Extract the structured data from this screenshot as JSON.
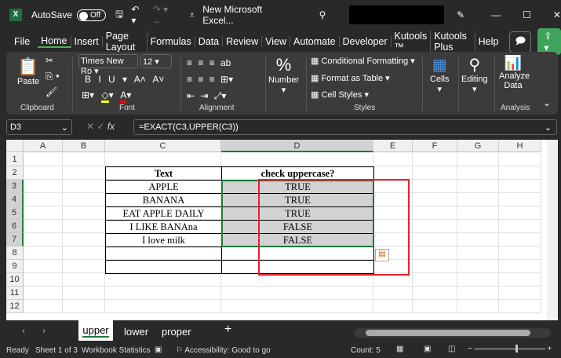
{
  "title": {
    "autosave": "AutoSave",
    "toggle": "Off",
    "filename": "New Microsoft Excel..."
  },
  "menu": [
    "File",
    "Home",
    "Insert",
    "Page Layout",
    "Formulas",
    "Data",
    "Review",
    "View",
    "Automate",
    "Developer",
    "Kutools ™",
    "Kutools Plus",
    "Help"
  ],
  "ribbon": {
    "paste": "Paste",
    "clipboard": "Clipboard",
    "font_name": "Times New Ro",
    "font_size": "12",
    "font": "Font",
    "alignment": "Alignment",
    "number": "Number",
    "cond": "Conditional Formatting",
    "fat": "Format as Table",
    "cs": "Cell Styles",
    "styles": "Styles",
    "cells": "Cells",
    "editing": "Editing",
    "analyze": "Analyze Data",
    "analysis": "Analysis"
  },
  "formula": {
    "name_box": "D3",
    "fx": "fx",
    "value": "=EXACT(C3,UPPER(C3))"
  },
  "columns": [
    "A",
    "B",
    "C",
    "D",
    "E",
    "F",
    "G",
    "H"
  ],
  "rows": [
    "1",
    "2",
    "3",
    "4",
    "5",
    "6",
    "7",
    "8",
    "9",
    "10",
    "11",
    "12"
  ],
  "table": {
    "headers": [
      "Text",
      "check uppercase?"
    ],
    "rows": [
      [
        "APPLE",
        "TRUE"
      ],
      [
        "BANANA",
        "TRUE"
      ],
      [
        "EAT APPLE DAILY",
        "TRUE"
      ],
      [
        "I LIKE BANAna",
        "FALSE"
      ],
      [
        "I love milk",
        "FALSE"
      ]
    ]
  },
  "tabs": [
    "upper",
    "lower",
    "proper"
  ],
  "status": {
    "ready": "Ready",
    "sheet": "Sheet 1 of 3",
    "wb": "Workbook Statistics",
    "acc": "Accessibility: Good to go",
    "count": "Count: 5"
  }
}
